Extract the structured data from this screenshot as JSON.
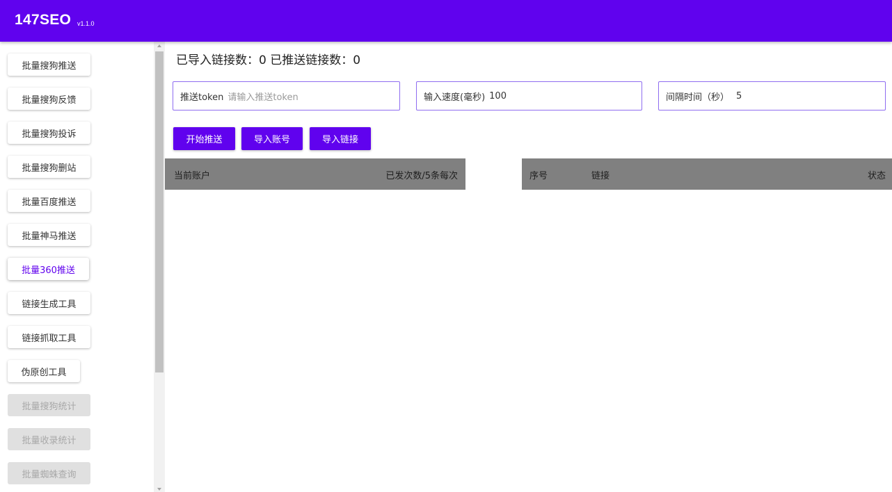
{
  "header": {
    "app_title": "147SEO",
    "version": "v1.1.0",
    "bar_color": "#6002ee"
  },
  "sidebar": {
    "items": [
      {
        "label": "批量搜狗推送",
        "state": "normal"
      },
      {
        "label": "批量搜狗反馈",
        "state": "normal"
      },
      {
        "label": "批量搜狗投诉",
        "state": "normal"
      },
      {
        "label": "批量搜狗删站",
        "state": "normal"
      },
      {
        "label": "批量百度推送",
        "state": "normal"
      },
      {
        "label": "批量神马推送",
        "state": "normal"
      },
      {
        "label": "批量360推送",
        "state": "active"
      },
      {
        "label": "链接生成工具",
        "state": "normal"
      },
      {
        "label": "链接抓取工具",
        "state": "normal"
      },
      {
        "label": "伪原创工具",
        "state": "normal"
      },
      {
        "label": "批量搜狗统计",
        "state": "disabled"
      },
      {
        "label": "批量收录统计",
        "state": "disabled"
      },
      {
        "label": "批量蜘蛛查询",
        "state": "disabled"
      }
    ]
  },
  "main": {
    "counts_text": "已导入链接数：0 已推送链接数：0",
    "fields": {
      "token": {
        "label": "推送token",
        "placeholder": "请输入推送token"
      },
      "speed": {
        "label": "输入速度(毫秒)",
        "value": "100"
      },
      "interval": {
        "label": "间隔时间（秒）",
        "value": "5"
      }
    },
    "buttons": {
      "start": "开始推送",
      "import_account": "导入账号",
      "import_links": "导入链接"
    },
    "accounts_table": {
      "columns": [
        "当前账户",
        "已发次数/5条每次"
      ]
    },
    "links_table": {
      "columns": [
        "序号",
        "链接",
        "状态"
      ]
    }
  }
}
